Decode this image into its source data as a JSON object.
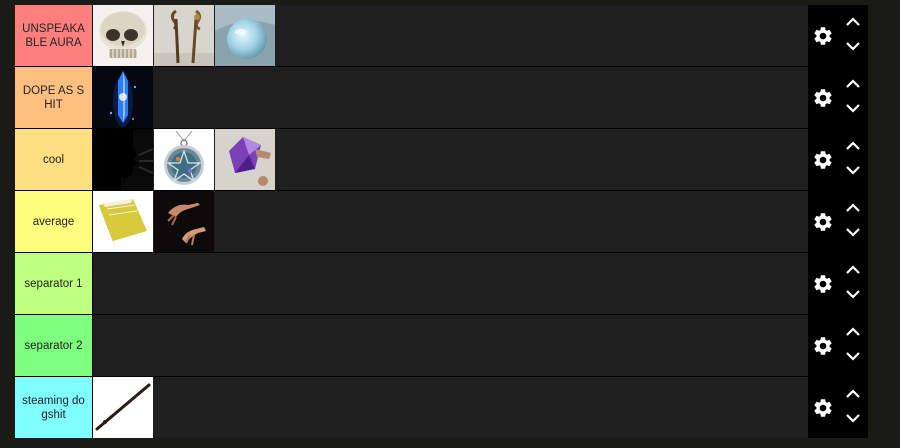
{
  "tiers": [
    {
      "label": "UNSPEAKABLE AURA",
      "color": "#ff7f7f",
      "items": [
        "skull-image",
        "wooden-staffs-image",
        "crystal-ball-image"
      ]
    },
    {
      "label": "DOPE AS SHIT",
      "color": "#ffbf7f",
      "items": [
        "glowing-blue-crystal-image"
      ]
    },
    {
      "label": "cool",
      "color": "#ffdf7f",
      "items": [
        "silhouette-shout-image",
        "pentacle-pendant-image",
        "amethyst-crystal-image"
      ]
    },
    {
      "label": "average",
      "color": "#ffff7f",
      "items": [
        "yellow-book-image",
        "dark-hands-image"
      ]
    },
    {
      "label": "separator 1",
      "color": "#bfff7f",
      "items": []
    },
    {
      "label": "separator 2",
      "color": "#7fff7f",
      "items": []
    },
    {
      "label": "steaming dogshit",
      "color": "#7fffff",
      "items": [
        "wand-image"
      ]
    }
  ],
  "icons": {
    "settings": "gear-icon",
    "move_up": "chevron-up-icon",
    "move_down": "chevron-down-icon"
  }
}
